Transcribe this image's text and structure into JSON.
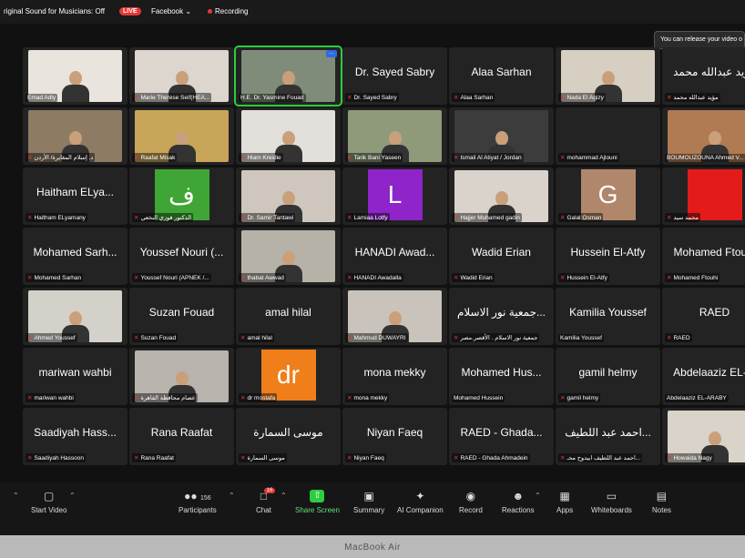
{
  "topbar": {
    "sound_label": "riginal Sound for Musicians: Off",
    "live_label": "LIVE",
    "facebook_label": "Facebook",
    "recording_label": "Recording"
  },
  "toast": {
    "text": "You can release your video o"
  },
  "tiles": [
    {
      "big": "",
      "cap": "Emad Adly",
      "type": "video",
      "bg": "#e9e4de",
      "muted": false
    },
    {
      "big": "",
      "cap": "Marie Therese Seif(HEA...",
      "type": "video",
      "bg": "#ddd6cf",
      "muted": true
    },
    {
      "big": "",
      "cap": "H.E. Dr. Yasmine Fouad",
      "type": "video",
      "bg": "#7f8c7a",
      "muted": false,
      "active": true
    },
    {
      "big": "Dr. Sayed Sabry",
      "cap": "Dr. Sayed Sabry",
      "type": "name",
      "muted": true
    },
    {
      "big": "Alaa Sarhan",
      "cap": "Alaa Sarhan",
      "type": "name",
      "muted": true
    },
    {
      "big": "",
      "cap": "Nada El Agizy",
      "type": "video",
      "bg": "#d8cfc3",
      "muted": true
    },
    {
      "big": "مؤيد عبدالله محمد",
      "cap": "مؤيد عبدالله محمد",
      "type": "name",
      "muted": true
    },
    {
      "big": "",
      "cap": "د. إسلام المغايرة/ الأردن",
      "type": "video",
      "bg": "#8d7b63",
      "muted": true
    },
    {
      "big": "",
      "cap": "Raafat Misak",
      "type": "video",
      "bg": "#c9a55a",
      "muted": true
    },
    {
      "big": "",
      "cap": "Hiam Kreidie",
      "type": "video",
      "bg": "#e3dfdb",
      "muted": true
    },
    {
      "big": "",
      "cap": "Tarik Bani Yaseen",
      "type": "video",
      "bg": "#8e9a7a",
      "muted": true
    },
    {
      "big": "",
      "cap": "Ismail  Al Atiyat / Jordan",
      "type": "video",
      "bg": "#3c3c3c",
      "muted": true
    },
    {
      "big": "",
      "cap": "mohammad Ajlouni",
      "type": "name",
      "muted": true
    },
    {
      "big": "",
      "cap": "BOUMOUZOUNA Ahmed V...",
      "type": "video",
      "bg": "#b07a52",
      "muted": false
    },
    {
      "big": "Haitham ELya...",
      "cap": "Haitham ELyamany",
      "type": "name",
      "muted": true
    },
    {
      "big": "ف",
      "cap": "الدكتور فوزي النخعي",
      "type": "avatar",
      "bg": "#3fa535",
      "muted": true
    },
    {
      "big": "",
      "cap": "Dr. Samir Tantawi",
      "type": "video",
      "bg": "#cfc7bd",
      "muted": true
    },
    {
      "big": "L",
      "cap": "Lamiaa Lotfy",
      "type": "avatar",
      "bg": "#8e24c9",
      "muted": true
    },
    {
      "big": "",
      "cap": "Hajjer Muhamed gadin",
      "type": "video",
      "bg": "#d9d3cb",
      "muted": true
    },
    {
      "big": "G",
      "cap": "Galal Osman",
      "type": "avatar",
      "bg": "#b0876b",
      "muted": true
    },
    {
      "big": "",
      "cap": "محمد سيد",
      "type": "avatar",
      "bg": "#e41b1b",
      "muted": true
    },
    {
      "big": "Mohamed Sarh...",
      "cap": "Mohamed Sarhan",
      "type": "name",
      "muted": true
    },
    {
      "big": "Youssef Nouri (...",
      "cap": "Youssef Nouri (APNEK /...",
      "type": "name",
      "muted": true
    },
    {
      "big": "",
      "cap": "thabat Awwad",
      "type": "video",
      "bg": "#b7b2a8",
      "muted": true
    },
    {
      "big": "HANADI Awad...",
      "cap": "HANADI Awadalla",
      "type": "name",
      "muted": true
    },
    {
      "big": "Wadid Erian",
      "cap": "Wadid Erian",
      "type": "name",
      "muted": true
    },
    {
      "big": "Hussein El-Atfy",
      "cap": "Hussein El-Atfy",
      "type": "name",
      "muted": true
    },
    {
      "big": "Mohamed Ftouhi",
      "cap": "Mohamed Ftouhi",
      "type": "name",
      "muted": true
    },
    {
      "big": "",
      "cap": "Ahmed Youssef",
      "type": "video",
      "bg": "#d4d0ca",
      "muted": true
    },
    {
      "big": "Suzan Fouad",
      "cap": "Suzan Fouad",
      "type": "name",
      "muted": true
    },
    {
      "big": "amal hilal",
      "cap": "amal hilal",
      "type": "name",
      "muted": true
    },
    {
      "big": "",
      "cap": "Mahmud DUWAYRI",
      "type": "video",
      "bg": "#c9c3bb",
      "muted": true
    },
    {
      "big": "جمعية نور الاسلام...",
      "cap": "جمعية نور الاسلام . الأقصر.مصر",
      "type": "name",
      "muted": true
    },
    {
      "big": "Kamilia Youssef",
      "cap": "Kamilia Youssef",
      "type": "name",
      "muted": false
    },
    {
      "big": "RAED",
      "cap": "RAED",
      "type": "name",
      "muted": true
    },
    {
      "big": "mariwan wahbi",
      "cap": "mariwan wahbi",
      "type": "name",
      "muted": true
    },
    {
      "big": "",
      "cap": "عصام محافظة القاهرة",
      "type": "video",
      "bg": "#b8b3ad",
      "muted": true
    },
    {
      "big": "dr",
      "cap": "dr mostafa",
      "type": "avatar",
      "bg": "#f07e1b",
      "muted": true
    },
    {
      "big": "mona mekky",
      "cap": "mona mekky",
      "type": "name",
      "muted": true
    },
    {
      "big": "Mohamed Hus...",
      "cap": "Mohamed Hussein",
      "type": "name",
      "muted": false
    },
    {
      "big": "gamil helmy",
      "cap": "gamil helmy",
      "type": "name",
      "muted": true
    },
    {
      "big": "Abdelaaziz EL-...",
      "cap": "Abdelaaziz EL-ARABY",
      "type": "name",
      "muted": false
    },
    {
      "big": "Saadiyah Hass...",
      "cap": "Saadiyah Hassoon",
      "type": "name",
      "muted": true
    },
    {
      "big": "Rana Raafat",
      "cap": "Rana Raafat",
      "type": "name",
      "muted": true
    },
    {
      "big": "موسى السمارة",
      "cap": "موسى السمارة",
      "type": "name",
      "muted": true
    },
    {
      "big": "Niyan Faeq",
      "cap": "Niyan Faeq",
      "type": "name",
      "muted": true
    },
    {
      "big": "RAED - Ghada...",
      "cap": "RAED - Ghada Ahmadein",
      "type": "name",
      "muted": true
    },
    {
      "big": "احمد عبد اللطيف...",
      "cap": "احمد عبد اللطيف ابيدوح محـ...",
      "type": "name",
      "muted": true
    },
    {
      "big": "",
      "cap": "Howaida Nagy",
      "type": "video",
      "bg": "#d9d3c9",
      "muted": true
    }
  ],
  "toolbar": {
    "start_video": "Start Video",
    "participants": "Participants",
    "participants_count": "156",
    "chat": "Chat",
    "chat_badge": "16",
    "share_screen": "Share Screen",
    "summary": "Summary",
    "ai_companion": "AI Companion",
    "record": "Record",
    "reactions": "Reactions",
    "apps": "Apps",
    "whiteboards": "Whiteboards",
    "notes": "Notes"
  },
  "bezel": {
    "label": "MacBook Air"
  },
  "colors": {
    "accent_green": "#2ecc40",
    "muted_red": "#e53935",
    "tile_bg": "#232323"
  }
}
